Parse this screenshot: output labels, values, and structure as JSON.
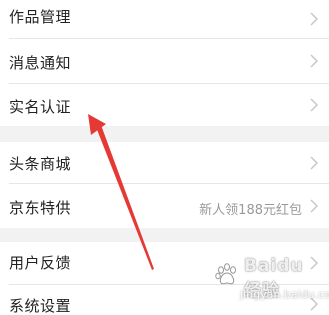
{
  "menu": {
    "group1": [
      {
        "label": "作品管理"
      },
      {
        "label": "消息通知"
      },
      {
        "label": "实名认证"
      }
    ],
    "group2": [
      {
        "label": "头条商城"
      },
      {
        "label": "京东特供",
        "value": "新人领188元红包"
      }
    ],
    "group3": [
      {
        "label": "用户反馈"
      },
      {
        "label": "系统设置"
      }
    ]
  },
  "annotation": {
    "arrow_color": "#e53935",
    "points_to": "实名认证"
  },
  "watermark": {
    "brand": "Baidu 经验",
    "url": "jingyan.baidu.com"
  },
  "colors": {
    "section_gap": "#f2f2f2",
    "divider": "#e6e6e6",
    "chevron": "#c8c8c8"
  }
}
